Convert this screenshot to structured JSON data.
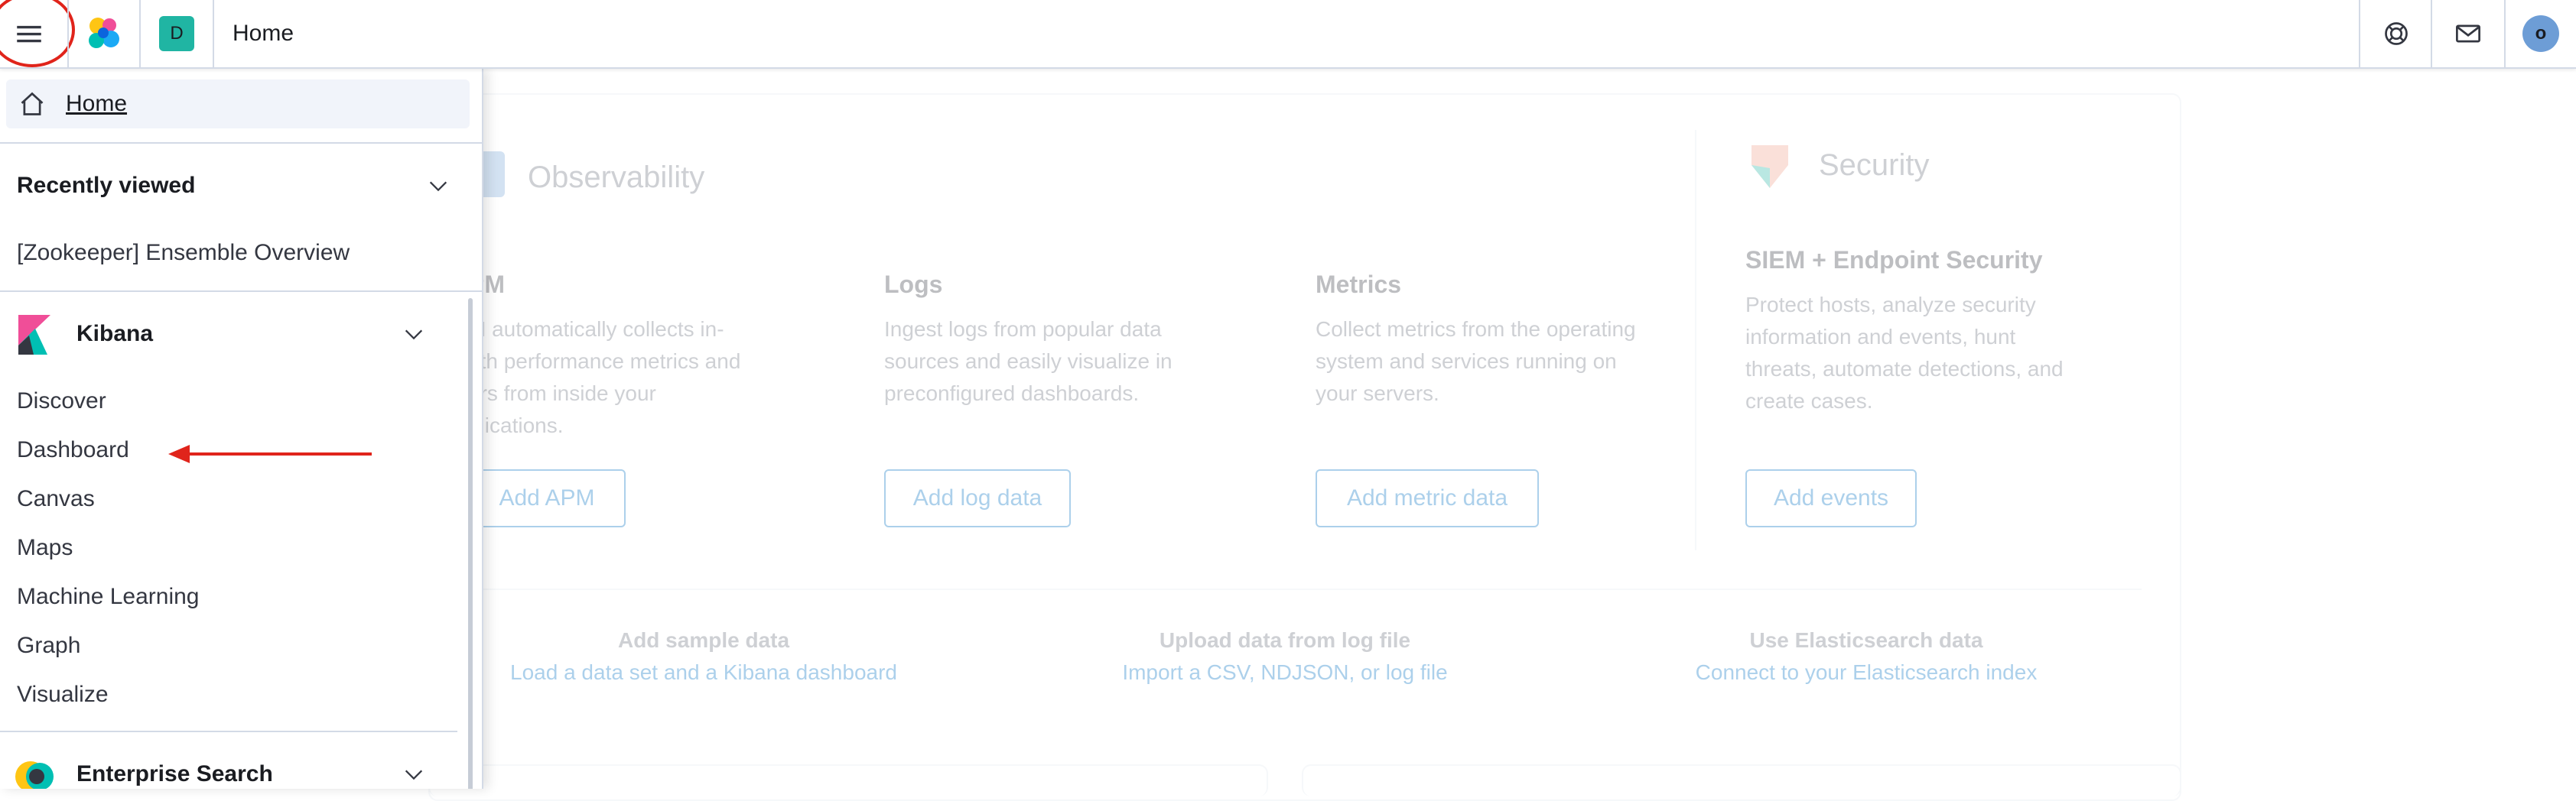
{
  "header": {
    "space_initial": "D",
    "breadcrumb": "Home",
    "user_initial": "o",
    "icons": [
      "menu-icon",
      "elastic-logo-icon",
      "help-icon",
      "newsfeed-icon"
    ]
  },
  "nav": {
    "home_label": "Home",
    "recently_viewed": {
      "title": "Recently viewed",
      "items": [
        "[Zookeeper] Ensemble Overview"
      ]
    },
    "kibana": {
      "title": "Kibana",
      "items": [
        "Discover",
        "Dashboard",
        "Canvas",
        "Maps",
        "Machine Learning",
        "Graph",
        "Visualize"
      ]
    },
    "enterprise_search": {
      "title": "Enterprise Search"
    }
  },
  "main": {
    "observability": {
      "title": "Observability",
      "apm": {
        "title": "PM",
        "desc_lines": [
          "M automatically collects in-",
          "pth performance metrics and",
          "ors from inside your",
          "plications."
        ],
        "button": "Add APM"
      },
      "logs": {
        "title": "Logs",
        "desc_lines": [
          "Ingest logs from popular data",
          "sources and easily visualize in",
          "preconfigured dashboards."
        ],
        "button": "Add log data"
      },
      "metrics": {
        "title": "Metrics",
        "desc_lines": [
          "Collect metrics from the operating",
          "system and services running on",
          "your servers."
        ],
        "button": "Add metric data"
      }
    },
    "security": {
      "title": "Security",
      "siem": {
        "title": "SIEM + Endpoint Security",
        "desc_lines": [
          "Protect hosts, analyze security",
          "information and events, hunt",
          "threats, automate detections, and",
          "create cases."
        ],
        "button": "Add events"
      }
    },
    "links": [
      {
        "title": "Add sample data",
        "sub": "Load a data set and a Kibana dashboard"
      },
      {
        "title": "Upload data from log file",
        "sub": "Import a CSV, NDJSON, or log file"
      },
      {
        "title": "Use Elasticsearch data",
        "sub": "Connect to your Elasticsearch index"
      }
    ]
  },
  "colors": {
    "annotation": "#e0241b",
    "link": "#0071c2",
    "space_avatar": "#20b5a3",
    "user_avatar": "#6d9dd6"
  }
}
